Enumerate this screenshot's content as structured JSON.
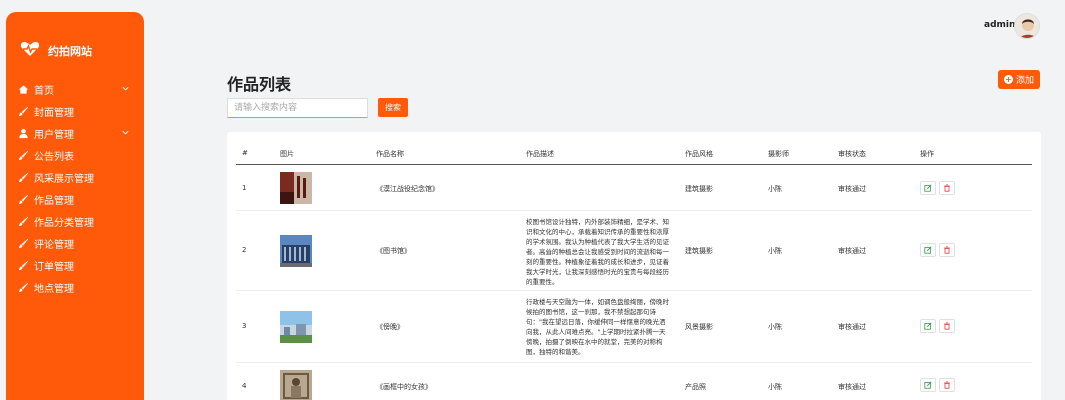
{
  "brand": {
    "name": "约拍网站"
  },
  "sidebar": {
    "items": [
      {
        "label": "首页",
        "icon": "home-icon"
      },
      {
        "label": "封面管理",
        "icon": "brush-icon"
      },
      {
        "label": "用户管理",
        "icon": "user-icon"
      },
      {
        "label": "公告列表",
        "icon": "brush-icon"
      },
      {
        "label": "风采展示管理",
        "icon": "brush-icon"
      },
      {
        "label": "作品管理",
        "icon": "brush-icon"
      },
      {
        "label": "作品分类管理",
        "icon": "brush-icon"
      },
      {
        "label": "评论管理",
        "icon": "brush-icon"
      },
      {
        "label": "订单管理",
        "icon": "brush-icon"
      },
      {
        "label": "地点管理",
        "icon": "brush-icon"
      }
    ]
  },
  "header": {
    "user": "admin"
  },
  "main": {
    "title": "作品列表",
    "add_label": "添加",
    "search_placeholder": "请输入搜索内容",
    "search_label": "搜索"
  },
  "table": {
    "headers": [
      "#",
      "图片",
      "作品名称",
      "作品描述",
      "作品风格",
      "摄影师",
      "审核状态",
      "操作"
    ],
    "rows": [
      {
        "index": "1",
        "name": "《漠江战役纪念馆》",
        "desc": "",
        "style": "建筑摄影",
        "photographer": "小陈",
        "status": "审核通过"
      },
      {
        "index": "2",
        "name": "《图书馆》",
        "desc": "校图书馆设计独特，内外部装饰精细，是学术、知识和文化的中心，承载着知识传承的重要性和浓厚的学术氛围。我认为种植代表了我大学生活的见证者。高耸的种植总会让我感受到时间的流逝和每一刻的重要性。种植象征着我的成长和进步，见证着我大学时光，让我深刻感悟时光的宝贵与每段经历的重要性。",
        "style": "建筑摄影",
        "photographer": "小陈",
        "status": "审核通过"
      },
      {
        "index": "3",
        "name": "《傍晚》",
        "desc": "行政楼与天空融为一体，如调色盘般绚丽，傍晚时候拍的图书馆，这一刹那，我不禁想起那句诗句：\"我在望远日落，你缓伸同一样惬意的晚光洒向我，从此人间难点亮。\"上学期时拉紧扑腾一天傍晚，拍摄了倒映在水中的就堂，完美的对称构图，独特的和谐美。",
        "style": "风景摄影",
        "photographer": "小陈",
        "status": "审核通过"
      },
      {
        "index": "4",
        "name": "《画框中的女孩》",
        "desc": "",
        "style": "产品照",
        "photographer": "小陈",
        "status": "审核通过"
      }
    ]
  },
  "colors": {
    "accent": "#ff5a0a",
    "edit": "#2e9a4a",
    "delete": "#e03a3a"
  }
}
